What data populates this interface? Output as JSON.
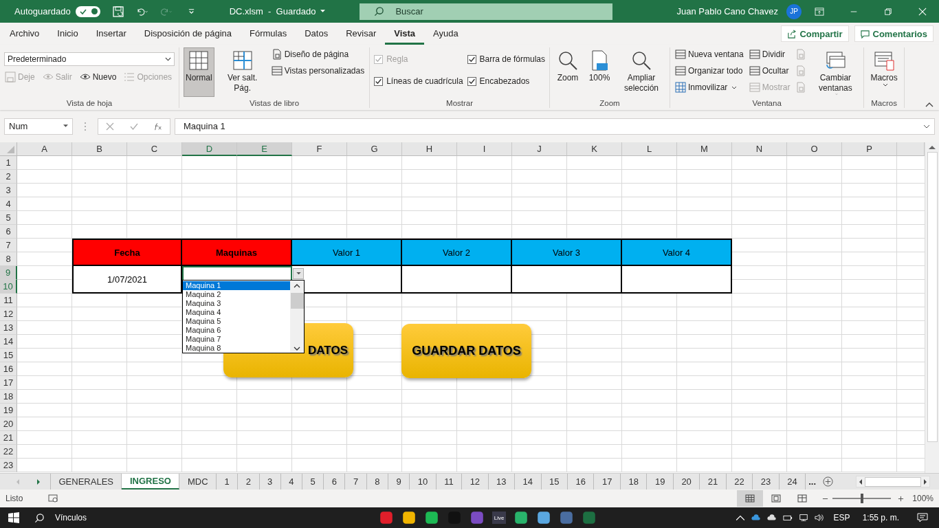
{
  "title_bar": {
    "autosave_label": "Autoguardado",
    "autosave_on": true,
    "document_title": "DC.xlsm  -  Guardado",
    "search_placeholder": "Buscar",
    "user_name": "Juan Pablo Cano Chavez",
    "user_initials": "JP"
  },
  "menu_tabs": [
    {
      "label": "Archivo",
      "selected": false
    },
    {
      "label": "Inicio",
      "selected": false
    },
    {
      "label": "Insertar",
      "selected": false
    },
    {
      "label": "Disposición de página",
      "selected": false
    },
    {
      "label": "Fórmulas",
      "selected": false
    },
    {
      "label": "Datos",
      "selected": false
    },
    {
      "label": "Revisar",
      "selected": false
    },
    {
      "label": "Vista",
      "selected": true
    },
    {
      "label": "Ayuda",
      "selected": false
    }
  ],
  "share_button": "Compartir",
  "comments_button": "Comentarios",
  "ribbon": {
    "groups": [
      {
        "label": "Vista de hoja",
        "lists": [
          [
            {
              "kind": "select",
              "label": "Predeterminado",
              "has_menu": true
            }
          ],
          [
            {
              "kind": "small",
              "label": "Deje",
              "disabled": true
            },
            {
              "kind": "small",
              "label": "Salir",
              "disabled": true
            },
            {
              "kind": "small",
              "label": "Nuevo",
              "disabled": false
            },
            {
              "kind": "small",
              "label": "Opciones",
              "disabled": true
            }
          ]
        ]
      },
      {
        "label": "Vistas de libro",
        "lists": [
          [
            {
              "kind": "large",
              "label": "Normal",
              "selected": true,
              "disabled": false
            }
          ],
          [
            {
              "kind": "large",
              "label": "Ver salt. Pág.",
              "selected": false,
              "disabled": false
            }
          ],
          [
            {
              "kind": "small",
              "label": "Diseño de página",
              "disabled": false
            },
            {
              "kind": "small",
              "label": "Vistas personalizadas",
              "disabled": false
            }
          ]
        ]
      },
      {
        "label": "Mostrar",
        "lists": [
          [
            {
              "kind": "check",
              "label": "Regla",
              "checked": true,
              "disabled": true
            },
            {
              "kind": "check",
              "label": "Líneas de cuadrícula",
              "checked": true,
              "disabled": false
            }
          ],
          [
            {
              "kind": "check",
              "label": "Barra de fórmulas",
              "checked": true,
              "disabled": false
            },
            {
              "kind": "check",
              "label": "Encabezados",
              "checked": true,
              "disabled": false
            }
          ]
        ]
      },
      {
        "label": "Zoom",
        "lists": [
          [
            {
              "kind": "large",
              "label": "Zoom",
              "disabled": false
            }
          ],
          [
            {
              "kind": "large",
              "label": "100%",
              "disabled": false
            }
          ],
          [
            {
              "kind": "large",
              "label": "Ampliar selección",
              "disabled": false
            }
          ]
        ]
      },
      {
        "label": "Ventana",
        "lists": [
          [
            {
              "kind": "small",
              "label": "Nueva ventana",
              "disabled": false
            },
            {
              "kind": "small",
              "label": "Organizar todo",
              "disabled": false
            },
            {
              "kind": "small",
              "label": "Inmovilizar",
              "has_menu": true,
              "disabled": false
            }
          ],
          [
            {
              "kind": "small",
              "label": "Dividir",
              "disabled": false
            },
            {
              "kind": "small",
              "label": "Ocultar",
              "disabled": false
            },
            {
              "kind": "small",
              "label": "Mostrar",
              "disabled": true
            }
          ],
          [
            {
              "kind": "icon",
              "disabled": true
            },
            {
              "kind": "icon",
              "disabled": true
            },
            {
              "kind": "icon",
              "disabled": true
            }
          ],
          [
            {
              "kind": "large",
              "label": "Cambiar ventanas",
              "has_menu": true,
              "disabled": false
            }
          ]
        ]
      },
      {
        "label": "Macros",
        "lists": [
          [
            {
              "kind": "large",
              "label": "Macros",
              "has_menu": true,
              "disabled": false
            }
          ]
        ]
      }
    ]
  },
  "formula_bar": {
    "name_box": "Num",
    "formula": "Maquina 1"
  },
  "columns": [
    {
      "label": "A",
      "selected": false
    },
    {
      "label": "B",
      "selected": false
    },
    {
      "label": "C",
      "selected": false
    },
    {
      "label": "D",
      "selected": true
    },
    {
      "label": "E",
      "selected": true
    },
    {
      "label": "F",
      "selected": false
    },
    {
      "label": "G",
      "selected": false
    },
    {
      "label": "H",
      "selected": false
    },
    {
      "label": "I",
      "selected": false
    },
    {
      "label": "J",
      "selected": false
    },
    {
      "label": "K",
      "selected": false
    },
    {
      "label": "L",
      "selected": false
    },
    {
      "label": "M",
      "selected": false
    },
    {
      "label": "N",
      "selected": false
    },
    {
      "label": "O",
      "selected": false
    },
    {
      "label": "P",
      "selected": false
    }
  ],
  "rows": [
    {
      "label": "1",
      "selected": false
    },
    {
      "label": "2",
      "selected": false
    },
    {
      "label": "3",
      "selected": false
    },
    {
      "label": "4",
      "selected": false
    },
    {
      "label": "5",
      "selected": false
    },
    {
      "label": "6",
      "selected": false
    },
    {
      "label": "7",
      "selected": false
    },
    {
      "label": "8",
      "selected": false
    },
    {
      "label": "9",
      "selected": true
    },
    {
      "label": "10",
      "selected": true
    },
    {
      "label": "11",
      "selected": false
    },
    {
      "label": "12",
      "selected": false
    },
    {
      "label": "13",
      "selected": false
    },
    {
      "label": "14",
      "selected": false
    },
    {
      "label": "15",
      "selected": false
    },
    {
      "label": "16",
      "selected": false
    },
    {
      "label": "17",
      "selected": false
    },
    {
      "label": "18",
      "selected": false
    },
    {
      "label": "19",
      "selected": false
    },
    {
      "label": "20",
      "selected": false
    },
    {
      "label": "21",
      "selected": false
    },
    {
      "label": "22",
      "selected": false
    },
    {
      "label": "23",
      "selected": false
    }
  ],
  "table": {
    "headers": [
      {
        "text": "Fecha",
        "color": "#ff0000",
        "bold": true
      },
      {
        "text": "Maquinas",
        "color": "#ff0000",
        "bold": true
      },
      {
        "text": "Valor 1",
        "color": "#00b0f0",
        "bold": false
      },
      {
        "text": "Valor 2",
        "color": "#00b0f0",
        "bold": false
      },
      {
        "text": "Valor 3",
        "color": "#00b0f0",
        "bold": false
      },
      {
        "text": "Valor 4",
        "color": "#00b0f0",
        "bold": false
      }
    ],
    "data_row": [
      {
        "text": "1/07/2021",
        "active": false
      },
      {
        "active": true
      },
      {
        "active": false
      },
      {
        "active": false
      },
      {
        "active": false
      },
      {
        "active": false
      }
    ]
  },
  "dropdown_list": [
    {
      "label": "Maquina 1",
      "selected": true
    },
    {
      "label": "Maquina 2",
      "selected": false
    },
    {
      "label": "Maquina 3",
      "selected": false
    },
    {
      "label": "Maquina 4",
      "selected": false
    },
    {
      "label": "Maquina 5",
      "selected": false
    },
    {
      "label": "Maquina 6",
      "selected": false
    },
    {
      "label": "Maquina 7",
      "selected": false
    },
    {
      "label": "Maquina 8",
      "selected": false
    }
  ],
  "shape_buttons": [
    {
      "text": "DATOS",
      "covered": true
    },
    {
      "text": "GUARDAR DATOS",
      "covered": false
    }
  ],
  "sheet_tabs": [
    {
      "label": "GENERALES",
      "selected": false
    },
    {
      "label": "INGRESO",
      "selected": true
    },
    {
      "label": "MDC",
      "selected": false
    },
    {
      "label": "1",
      "selected": false
    },
    {
      "label": "2",
      "selected": false
    },
    {
      "label": "3",
      "selected": false
    },
    {
      "label": "4",
      "selected": false
    },
    {
      "label": "5",
      "selected": false
    },
    {
      "label": "6",
      "selected": false
    },
    {
      "label": "7",
      "selected": false
    },
    {
      "label": "8",
      "selected": false
    },
    {
      "label": "9",
      "selected": false
    },
    {
      "label": "10",
      "selected": false
    },
    {
      "label": "11",
      "selected": false
    },
    {
      "label": "12",
      "selected": false
    },
    {
      "label": "13",
      "selected": false
    },
    {
      "label": "14",
      "selected": false
    },
    {
      "label": "15",
      "selected": false
    },
    {
      "label": "16",
      "selected": false
    },
    {
      "label": "17",
      "selected": false
    },
    {
      "label": "18",
      "selected": false
    },
    {
      "label": "19",
      "selected": false
    },
    {
      "label": "20",
      "selected": false
    },
    {
      "label": "21",
      "selected": false
    },
    {
      "label": "22",
      "selected": false
    },
    {
      "label": "23",
      "selected": false
    },
    {
      "label": "24",
      "selected": false
    }
  ],
  "sheet_tabs_overflow": "...",
  "status_bar": {
    "status": "Listo",
    "zoom": {
      "level": 0.5,
      "reading": "100%"
    }
  },
  "taskbar": {
    "search_label": "Vínculos",
    "live_tile": "Live",
    "language": "ESP",
    "time": "1:55 p. m."
  }
}
